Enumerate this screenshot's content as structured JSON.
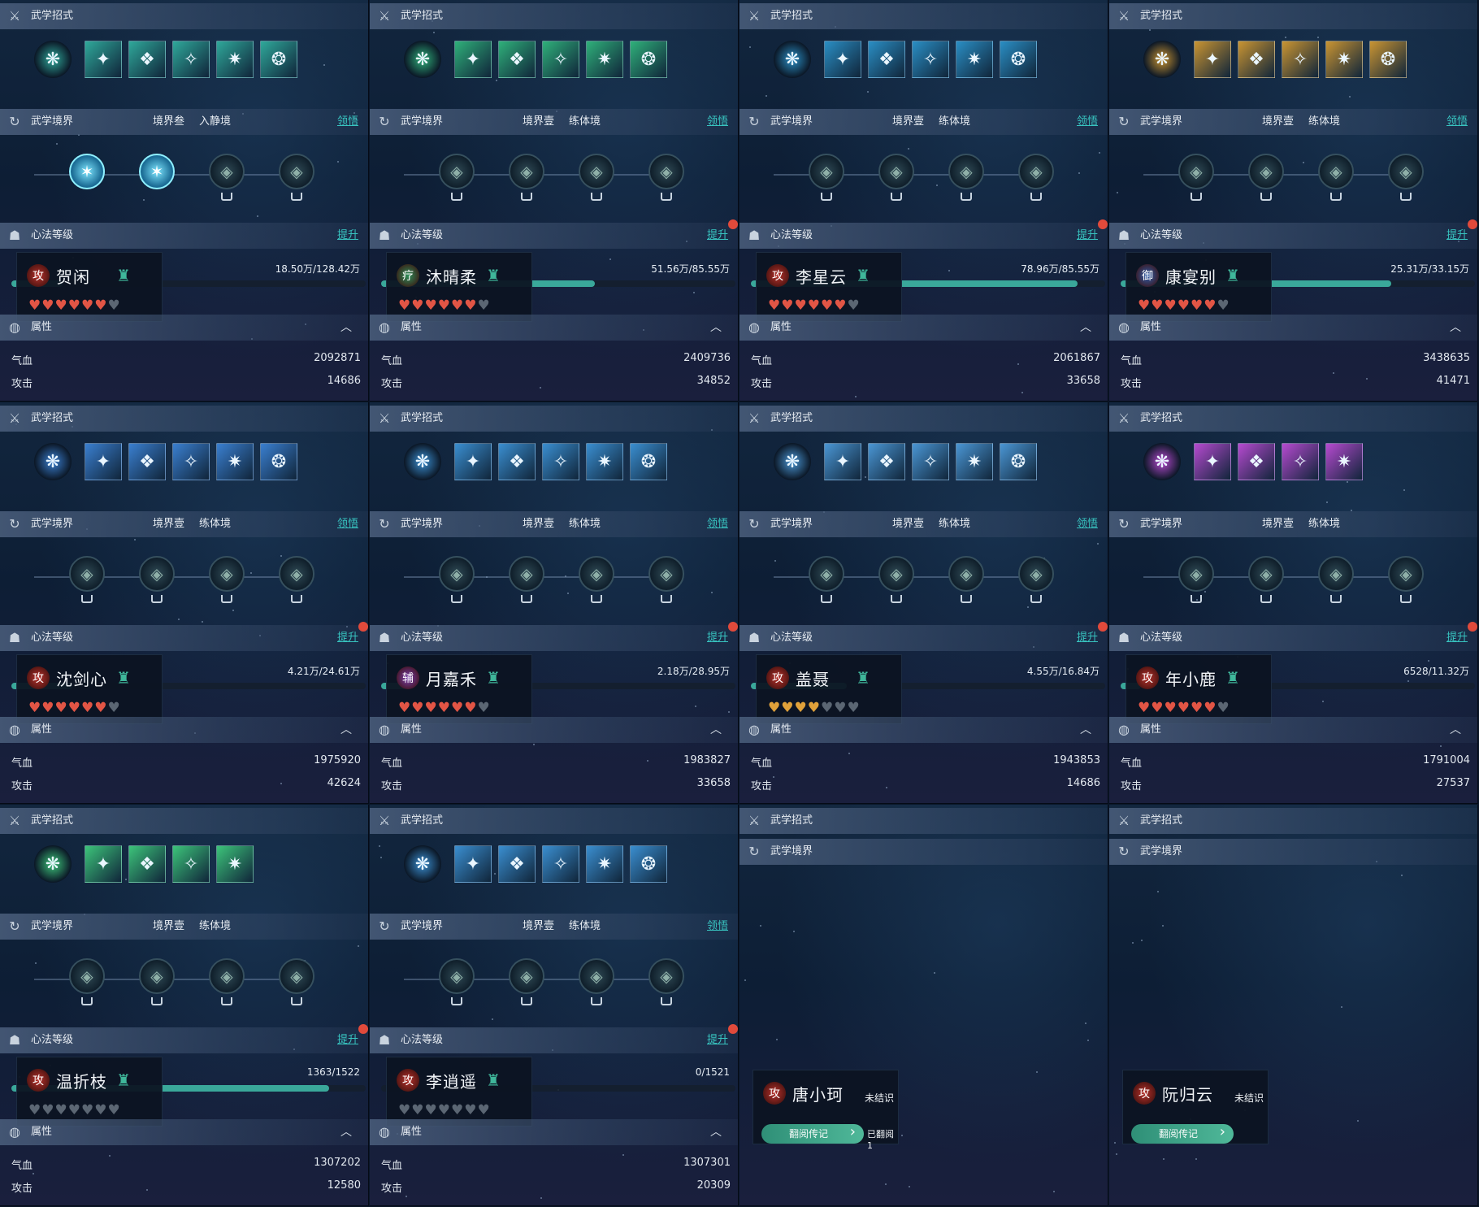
{
  "labels": {
    "moves": "武学招式",
    "realm": "武学境界",
    "mind": "心法等级",
    "attr": "属性",
    "hp": "气血",
    "atk": "攻击",
    "comprehend": "领悟",
    "upgrade": "提升",
    "unrecognized": "未结识",
    "read_bio": "翻阅传记",
    "read_count": "已翻阅1"
  },
  "colors": {
    "accent": "#38c4c0",
    "progress": "#3aa89a",
    "heart_red": "#e25545",
    "heart_gold": "#e0a13a",
    "heart_empty": "#5b6673",
    "reddot": "#e14a3b"
  },
  "characters": [
    {
      "name": "贺闲",
      "role": "攻",
      "realm_level": "境界叁",
      "realm_stage": "入静境",
      "has_comprehend": true,
      "progress_text": "18.50万/128.42万",
      "progress": 0.144,
      "hearts": {
        "filled": 6,
        "total": 7,
        "tone": "red"
      },
      "hp": "2092871",
      "atk": "14686",
      "theme": "#2fa89a",
      "upgrade_dot": false,
      "active_nodes": 2
    },
    {
      "name": "沐晴柔",
      "role": "疗",
      "realm_level": "境界壹",
      "realm_stage": "练体境",
      "has_comprehend": true,
      "progress_text": "51.56万/85.55万",
      "progress": 0.603,
      "hearts": {
        "filled": 6,
        "total": 7,
        "tone": "red"
      },
      "hp": "2409736",
      "atk": "34852",
      "theme": "#2fb07a",
      "upgrade_dot": true,
      "active_nodes": 0
    },
    {
      "name": "李星云",
      "role": "攻",
      "realm_level": "境界壹",
      "realm_stage": "练体境",
      "has_comprehend": true,
      "progress_text": "78.96万/85.55万",
      "progress": 0.923,
      "hearts": {
        "filled": 6,
        "total": 7,
        "tone": "red"
      },
      "hp": "2061867",
      "atk": "33658",
      "theme": "#2a8ec4",
      "upgrade_dot": true,
      "active_nodes": 0
    },
    {
      "name": "康宴别",
      "role": "御",
      "realm_level": "境界壹",
      "realm_stage": "练体境",
      "has_comprehend": true,
      "progress_text": "25.31万/33.15万",
      "progress": 0.763,
      "hearts": {
        "filled": 6,
        "total": 7,
        "tone": "red"
      },
      "hp": "3438635",
      "atk": "41471",
      "theme": "#c99432",
      "upgrade_dot": true,
      "active_nodes": 0
    },
    {
      "name": "沈剑心",
      "role": "攻",
      "realm_level": "境界壹",
      "realm_stage": "练体境",
      "has_comprehend": true,
      "progress_text": "4.21万/24.61万",
      "progress": 0.171,
      "hearts": {
        "filled": 6,
        "total": 7,
        "tone": "red"
      },
      "hp": "1975920",
      "atk": "42624",
      "theme": "#3a7fd0",
      "upgrade_dot": true,
      "active_nodes": 0
    },
    {
      "name": "月嘉禾",
      "role": "辅",
      "realm_level": "境界壹",
      "realm_stage": "练体境",
      "has_comprehend": true,
      "progress_text": "2.18万/28.95万",
      "progress": 0.075,
      "hearts": {
        "filled": 6,
        "total": 7,
        "tone": "red"
      },
      "hp": "1983827",
      "atk": "33658",
      "theme": "#3a8ed0",
      "upgrade_dot": true,
      "active_nodes": 0
    },
    {
      "name": "盖聂",
      "role": "攻",
      "realm_level": "境界壹",
      "realm_stage": "练体境",
      "has_comprehend": true,
      "progress_text": "4.55万/16.84万",
      "progress": 0.27,
      "hearts": {
        "filled": 4,
        "total": 7,
        "tone": "gold"
      },
      "hp": "1943853",
      "atk": "14686",
      "theme": "#4a96d4",
      "upgrade_dot": true,
      "active_nodes": 0
    },
    {
      "name": "年小鹿",
      "role": "攻",
      "realm_level": "境界壹",
      "realm_stage": "练体境",
      "has_comprehend": false,
      "progress_text": "6528/11.32万",
      "progress": 0.058,
      "hearts": {
        "filled": 6,
        "total": 7,
        "tone": "red"
      },
      "hp": "1791004",
      "atk": "27537",
      "theme": "#b64ad0",
      "upgrade_dot": true,
      "active_nodes": 0
    },
    {
      "name": "温折枝",
      "role": "攻",
      "realm_level": "境界壹",
      "realm_stage": "练体境",
      "has_comprehend": false,
      "progress_text": "1363/1522",
      "progress": 0.896,
      "hearts": {
        "filled": 0,
        "total": 7,
        "tone": "red"
      },
      "hp": "1307202",
      "atk": "12580",
      "theme": "#3cc47a",
      "upgrade_dot": true,
      "active_nodes": 0
    },
    {
      "name": "李逍遥",
      "role": "攻",
      "realm_level": "境界壹",
      "realm_stage": "练体境",
      "has_comprehend": true,
      "progress_text": "0/1521",
      "progress": 0.0,
      "hearts": {
        "filled": 0,
        "total": 7,
        "tone": "red"
      },
      "hp": "1307301",
      "atk": "20309",
      "theme": "#3a8ed0",
      "upgrade_dot": true,
      "active_nodes": 0
    }
  ],
  "locked": [
    {
      "name": "唐小珂",
      "role": "攻"
    },
    {
      "name": "阮归云",
      "role": "攻"
    }
  ]
}
